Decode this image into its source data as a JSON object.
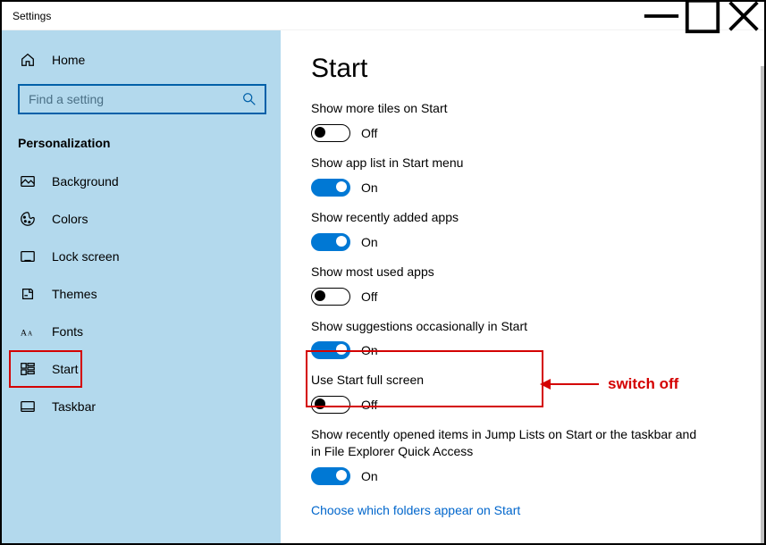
{
  "window": {
    "title": "Settings"
  },
  "sidebar": {
    "home_label": "Home",
    "search_placeholder": "Find a setting",
    "section_label": "Personalization",
    "items": [
      {
        "label": "Background"
      },
      {
        "label": "Colors"
      },
      {
        "label": "Lock screen"
      },
      {
        "label": "Themes"
      },
      {
        "label": "Fonts"
      },
      {
        "label": "Start"
      },
      {
        "label": "Taskbar"
      }
    ]
  },
  "page": {
    "title": "Start",
    "settings": [
      {
        "label": "Show more tiles on Start",
        "on": false,
        "state": "Off"
      },
      {
        "label": "Show app list in Start menu",
        "on": true,
        "state": "On"
      },
      {
        "label": "Show recently added apps",
        "on": true,
        "state": "On"
      },
      {
        "label": "Show most used apps",
        "on": false,
        "state": "Off"
      },
      {
        "label": "Show suggestions occasionally in Start",
        "on": true,
        "state": "On"
      },
      {
        "label": "Use Start full screen",
        "on": false,
        "state": "Off"
      },
      {
        "label": "Show recently opened items in Jump Lists on Start or the taskbar and in File Explorer Quick Access",
        "on": true,
        "state": "On"
      }
    ],
    "link": "Choose which folders appear on Start"
  },
  "annotation": {
    "text": "switch off"
  }
}
